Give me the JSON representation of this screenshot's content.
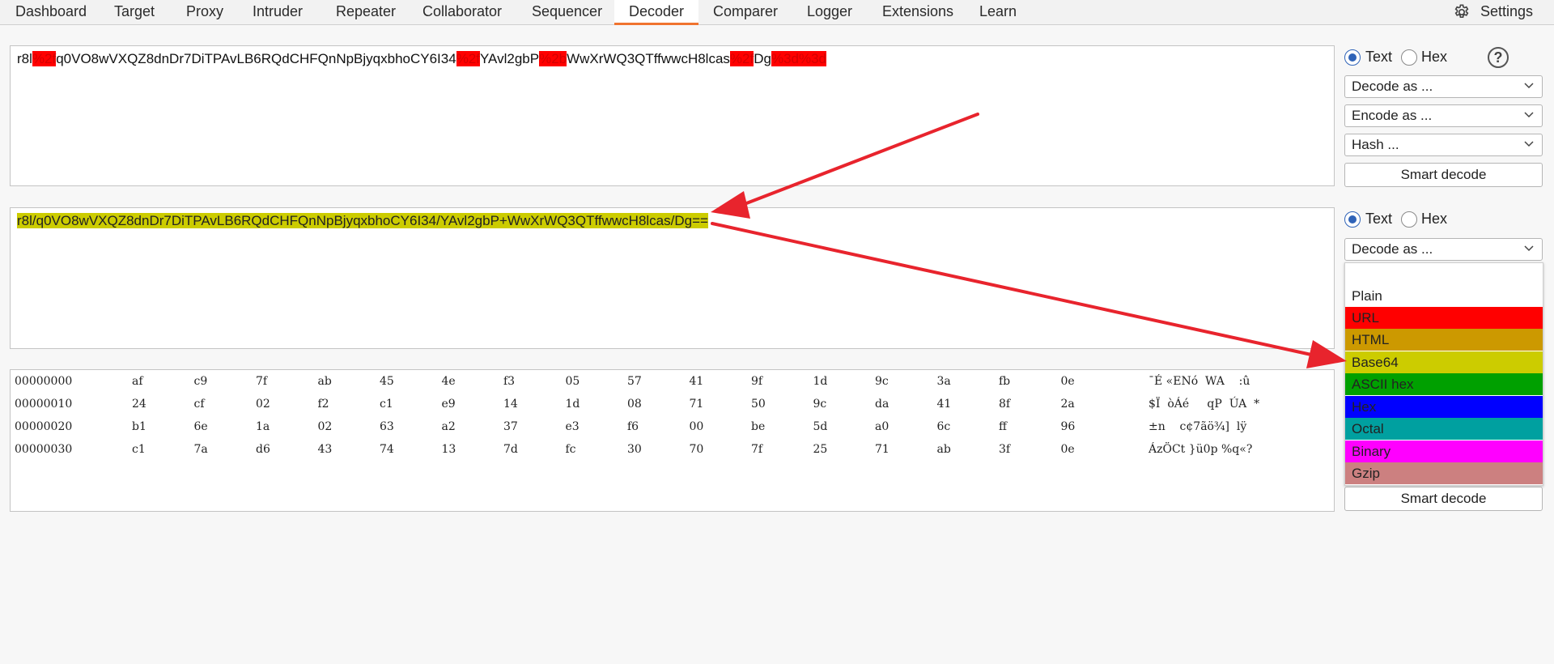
{
  "tabs": [
    {
      "label": "Dashboard"
    },
    {
      "label": "Target"
    },
    {
      "label": "Proxy"
    },
    {
      "label": "Intruder"
    },
    {
      "label": "Repeater"
    },
    {
      "label": "Collaborator"
    },
    {
      "label": "Sequencer"
    },
    {
      "label": "Decoder"
    },
    {
      "label": "Comparer"
    },
    {
      "label": "Logger"
    },
    {
      "label": "Extensions"
    },
    {
      "label": "Learn"
    }
  ],
  "active_tab": "Decoder",
  "settings_label": "Settings",
  "panel1": {
    "segments": [
      {
        "text": "r8l",
        "hl": false
      },
      {
        "text": "%2f",
        "hl": true
      },
      {
        "text": "q0VO8wVXQZ8dnDr7DiTPAvLB6RQdCHFQnNpBjyqxbhoCY6I34",
        "hl": false
      },
      {
        "text": "%2f",
        "hl": true
      },
      {
        "text": "YAvl2gbP",
        "hl": false
      },
      {
        "text": "%2b",
        "hl": true
      },
      {
        "text": "WwXrWQ3QTffwwcH8lcas",
        "hl": false
      },
      {
        "text": "%2f",
        "hl": true
      },
      {
        "text": "Dg",
        "hl": false
      },
      {
        "text": "%3d%3d",
        "hl": true
      }
    ],
    "radio_text": "Text",
    "radio_hex": "Hex",
    "help": "?",
    "decode_as": "Decode as ...",
    "encode_as": "Encode as ...",
    "hash": "Hash ...",
    "smart_decode": "Smart decode"
  },
  "panel2": {
    "text": "r8l/q0VO8wVXQZ8dnDr7DiTPAvLB6RQdCHFQnNpBjyqxbhoCY6I34/YAvl2gbP+WwXrWQ3QTffwwcH8lcas/Dg==",
    "radio_text": "Text",
    "radio_hex": "Hex",
    "decode_as": "Decode as ..."
  },
  "dropdown": {
    "items": [
      {
        "label": "Plain",
        "color": "#ffffff"
      },
      {
        "label": "URL",
        "color": "#ff0000"
      },
      {
        "label": "HTML",
        "color": "#cc9900"
      },
      {
        "label": "Base64",
        "color": "#cccc00"
      },
      {
        "label": "ASCII hex",
        "color": "#00a000"
      },
      {
        "label": "Hex",
        "color": "#0000ff"
      },
      {
        "label": "Octal",
        "color": "#00a0a0"
      },
      {
        "label": "Binary",
        "color": "#ff00ff"
      },
      {
        "label": "Gzip",
        "color": "#cc8080"
      }
    ]
  },
  "hex_view": {
    "rows": [
      {
        "offset": "00000000",
        "bytes": [
          "af",
          "c9",
          "7f",
          "ab",
          "45",
          "4e",
          "f3",
          "05",
          "57",
          "41",
          "9f",
          "1d",
          "9c",
          "3a",
          "fb",
          "0e"
        ],
        "ascii": "¯É «ENó  WA    :û"
      },
      {
        "offset": "00000010",
        "bytes": [
          "24",
          "cf",
          "02",
          "f2",
          "c1",
          "e9",
          "14",
          "1d",
          "08",
          "71",
          "50",
          "9c",
          "da",
          "41",
          "8f",
          "2a"
        ],
        "ascii": "$Ï  òÁé     qP  ÚA  *"
      },
      {
        "offset": "00000020",
        "bytes": [
          "b1",
          "6e",
          "1a",
          "02",
          "63",
          "a2",
          "37",
          "e3",
          "f6",
          "00",
          "be",
          "5d",
          "a0",
          "6c",
          "ff",
          "96"
        ],
        "ascii": "±n    c¢7ãö¾]  lÿ"
      },
      {
        "offset": "00000030",
        "bytes": [
          "c1",
          "7a",
          "d6",
          "43",
          "74",
          "13",
          "7d",
          "fc",
          "30",
          "70",
          "7f",
          "25",
          "71",
          "ab",
          "3f",
          "0e"
        ],
        "ascii": "ÁzÖCt }ü0p %q«?"
      }
    ]
  },
  "panel3": {
    "smart_decode": "Smart decode"
  },
  "colors": {
    "accent_tab": "#f0742f",
    "radio": "#2f63b8",
    "arrow": "#e8242d"
  }
}
